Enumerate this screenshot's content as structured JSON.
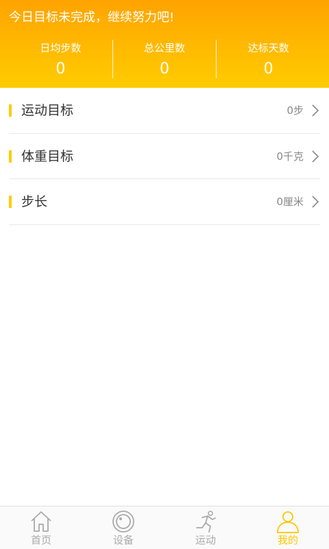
{
  "header": {
    "message": "今日目标未完成，继续努力吧!",
    "stats": [
      {
        "label": "日均步数",
        "value": "0"
      },
      {
        "label": "总公里数",
        "value": "0"
      },
      {
        "label": "达标天数",
        "value": "0"
      }
    ]
  },
  "settings": [
    {
      "label": "运动目标",
      "value": "0步"
    },
    {
      "label": "体重目标",
      "value": "0千克"
    },
    {
      "label": "步长",
      "value": "0厘米"
    }
  ],
  "tabs": [
    {
      "label": "首页",
      "icon": "home-icon"
    },
    {
      "label": "设备",
      "icon": "device-icon"
    },
    {
      "label": "运动",
      "icon": "running-icon"
    },
    {
      "label": "我的",
      "icon": "profile-icon",
      "active": true
    }
  ],
  "colors": {
    "accent": "#ffcc00",
    "header_top": "#ffa300",
    "tab_active": "#ffc600",
    "tab_inactive": "#aaaaaa"
  }
}
